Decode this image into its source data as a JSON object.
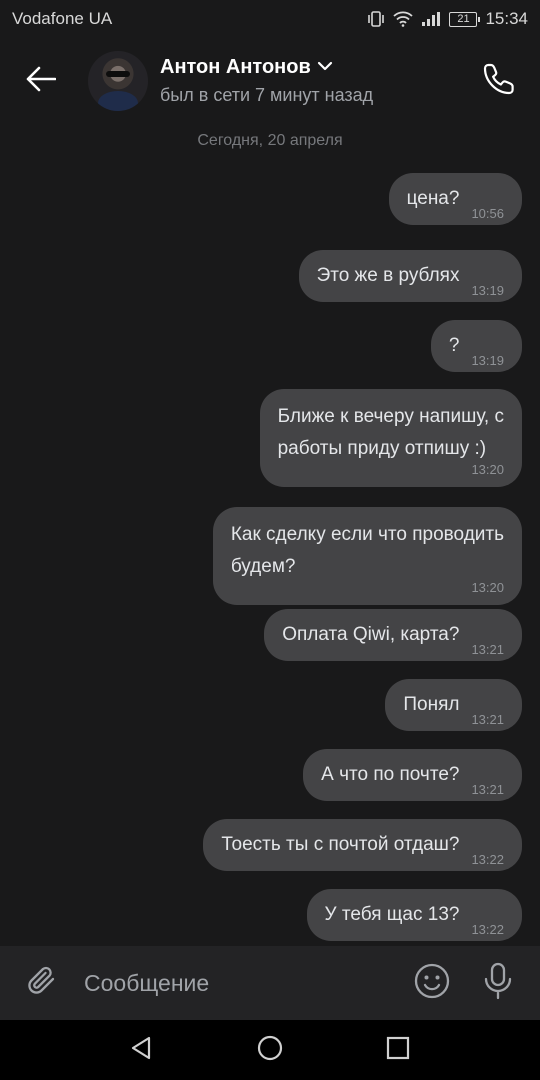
{
  "status_bar": {
    "carrier": "Vodafone UA",
    "battery": "21",
    "time": "15:34",
    "icons": [
      "vibrate-icon",
      "wifi-icon",
      "signal-icon",
      "battery-icon"
    ]
  },
  "header": {
    "contact_name": "Антон Антонов",
    "status": "был в сети 7 минут назад",
    "icons": [
      "back-arrow-icon",
      "chevron-down-icon",
      "phone-icon"
    ]
  },
  "chat": {
    "date_separator": "Сегодня, 20 апреля",
    "messages": [
      {
        "text": "цена?",
        "time": "10:56"
      },
      {
        "text": "Это же в рублях",
        "time": "13:19"
      },
      {
        "text": "?",
        "time": "13:19"
      },
      {
        "text": "Ближе к вечеру напишу, с\nработы приду отпишу :)",
        "time": "13:20"
      },
      {
        "text": "Как сделку если что проводить\nбудем?",
        "time": "13:20"
      },
      {
        "text": "Оплата Qiwi, карта?",
        "time": "13:21"
      },
      {
        "text": "Понял",
        "time": "13:21"
      },
      {
        "text": "А что по почте?",
        "time": "13:21"
      },
      {
        "text": "Тоесть ты с почтой отдаш?",
        "time": "13:22"
      },
      {
        "text": "У тебя щас 13?",
        "time": "13:22"
      }
    ]
  },
  "composer": {
    "placeholder": "Сообщение",
    "icons": [
      "paperclip-icon",
      "emoji-icon",
      "microphone-icon"
    ]
  },
  "nav_bar": {
    "icons": [
      "nav-back-icon",
      "nav-home-icon",
      "nav-recents-icon"
    ]
  },
  "colors": {
    "background": "#19191a",
    "bubble": "#444446",
    "composer": "#232325",
    "text": "#e4e6e9",
    "muted": "#a0a3a8"
  }
}
